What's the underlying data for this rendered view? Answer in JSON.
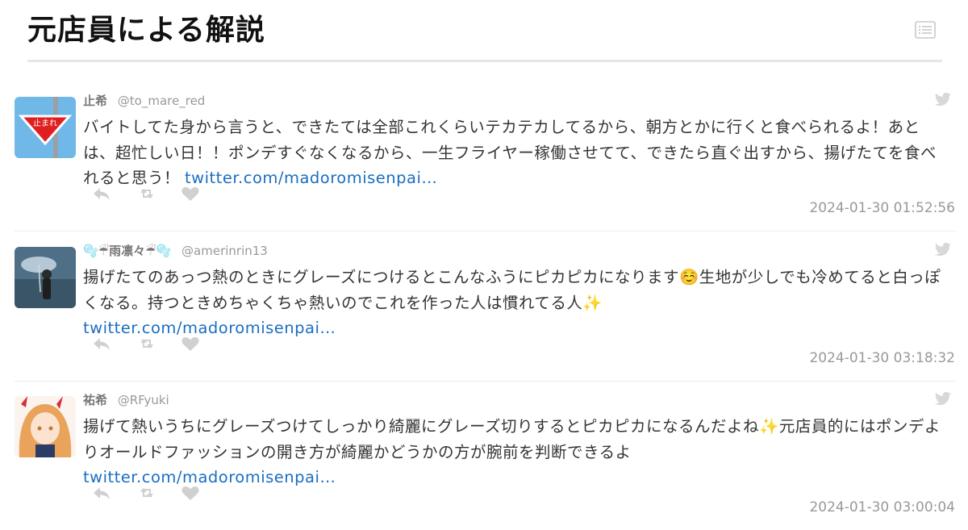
{
  "page": {
    "title": "元店員による解説"
  },
  "icons": {
    "toc": "list-icon",
    "tweet_source": "twitter-bird-icon",
    "reply": "reply-icon",
    "retweet": "retweet-icon",
    "like": "heart-icon"
  },
  "colors": {
    "link": "#1a6ec1",
    "icon_gray": "#d0d0d0",
    "divider": "#e6e6e6"
  },
  "tweets": [
    {
      "name": "止希",
      "handle": "@to_mare_red",
      "text": "バイトしてた身から言うと、できたては全部これくらいテカテカしてるから、朝方とかに行くと食べられるよ！あとは、超忙しい日！！ポンデすぐなくなるから、一生フライヤー稼働させてて、できたら直ぐ出すから、揚げたてを食べれると思う！",
      "link": "twitter.com/madoromisenpai…",
      "timestamp": "2024-01-30 01:52:56",
      "avatar_sign_text": "止まれ"
    },
    {
      "name": "🫧☔雨凛々☔🫧",
      "handle": "@amerinrin13",
      "text": "揚げたてのあっつ熱のときにグレーズにつけるとこんなふうにピカピカになります☺️生地が少しでも冷めてると白っぽくなる。持つときめちゃくちゃ熱いのでこれを作った人は慣れてる人✨",
      "link": "twitter.com/madoromisenpai…",
      "timestamp": "2024-01-30 03:18:32"
    },
    {
      "name": "祐希",
      "handle": "@RFyuki",
      "text": "揚げて熱いうちにグレーズつけてしっかり綺麗にグレーズ切りするとピカピカになるんだよね✨元店員的にはポンデよりオールドファッションの開き方が綺麗かどうかの方が腕前を判断できるよ",
      "link": "twitter.com/madoromisenpai…",
      "timestamp": "2024-01-30 03:00:04"
    }
  ]
}
